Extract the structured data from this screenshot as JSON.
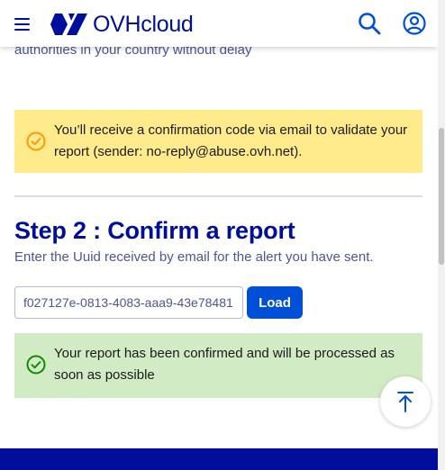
{
  "header": {
    "logo_text": "OVHcloud",
    "menu_icon": "hamburger-icon",
    "search_icon": "search-icon",
    "account_icon": "user-circle-icon"
  },
  "partial_text": "authorities in your country without delay",
  "warning_alert": {
    "icon": "check-circle-icon",
    "text": "You’ll receive a confirmation code via email to validate your report (sender: no-reply@abuse.ovh.net)."
  },
  "step2": {
    "title": "Step 2 : Confirm a report",
    "description": "Enter the Uuid received by email for the alert you have sent."
  },
  "uuid_input": {
    "value": "f027127e-0813-4083-aaa9-43e78481"
  },
  "load_button": {
    "label": "Load"
  },
  "success_alert": {
    "icon": "check-circle-icon",
    "text": "Your report has been confirmed and will be processed as soon as possible"
  },
  "scroll_top_icon": "arrow-up-to-top-icon",
  "colors": {
    "brand": "#000e9c",
    "primary_button": "#0050d7",
    "warning_bg": "#ffeb8b",
    "warning_icon": "#ff9803",
    "success_bg": "#d1ebc4",
    "success_icon": "#118a00"
  }
}
